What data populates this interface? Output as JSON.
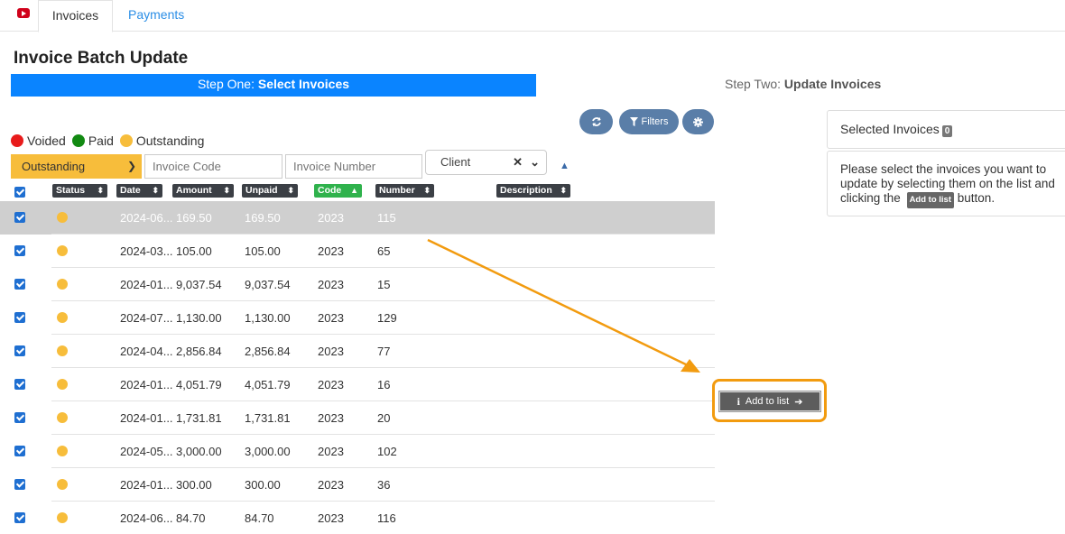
{
  "tabs": [
    {
      "label": "Invoices",
      "active": true
    },
    {
      "label": "Payments",
      "active": false
    }
  ],
  "page_title": "Invoice Batch Update",
  "steps": {
    "one_prefix": "Step One: ",
    "one_bold": "Select Invoices",
    "two_prefix": "Step Two: ",
    "two_bold": "Update Invoices"
  },
  "toolbar": {
    "filters_label": "Filters"
  },
  "legend": [
    {
      "label": "Voided",
      "color": "#e81b1b"
    },
    {
      "label": "Paid",
      "color": "#128a12"
    },
    {
      "label": "Outstanding",
      "color": "#f7bd3b"
    }
  ],
  "filters": {
    "status_value": "Outstanding",
    "invoice_code_placeholder": "Invoice Code",
    "invoice_number_placeholder": "Invoice Number",
    "client_placeholder": "Client"
  },
  "columns": {
    "status": "Status",
    "date": "Date",
    "amount": "Amount",
    "unpaid": "Unpaid",
    "code": "Code",
    "number": "Number",
    "description": "Description"
  },
  "rows": [
    {
      "date": "2024-06...",
      "amount": "169.50",
      "unpaid": "169.50",
      "code": "2023",
      "number": "115",
      "selected": true
    },
    {
      "date": "2024-03...",
      "amount": "105.00",
      "unpaid": "105.00",
      "code": "2023",
      "number": "65"
    },
    {
      "date": "2024-01...",
      "amount": "9,037.54",
      "unpaid": "9,037.54",
      "code": "2023",
      "number": "15"
    },
    {
      "date": "2024-07...",
      "amount": "1,130.00",
      "unpaid": "1,130.00",
      "code": "2023",
      "number": "129"
    },
    {
      "date": "2024-04...",
      "amount": "2,856.84",
      "unpaid": "2,856.84",
      "code": "2023",
      "number": "77"
    },
    {
      "date": "2024-01...",
      "amount": "4,051.79",
      "unpaid": "4,051.79",
      "code": "2023",
      "number": "16"
    },
    {
      "date": "2024-01...",
      "amount": "1,731.81",
      "unpaid": "1,731.81",
      "code": "2023",
      "number": "20"
    },
    {
      "date": "2024-05...",
      "amount": "3,000.00",
      "unpaid": "3,000.00",
      "code": "2023",
      "number": "102"
    },
    {
      "date": "2024-01...",
      "amount": "300.00",
      "unpaid": "300.00",
      "code": "2023",
      "number": "36"
    },
    {
      "date": "2024-06...",
      "amount": "84.70",
      "unpaid": "84.70",
      "code": "2023",
      "number": "116"
    }
  ],
  "selected_panel": {
    "title": "Selected Invoices",
    "count": "0",
    "message_before": "Please select the invoices you want to update by selecting them on the list and clicking the",
    "message_badge": "Add to list",
    "message_after": "button."
  },
  "add_to_list_label": "Add to list",
  "colors": {
    "accent_blue": "#0a84ff",
    "outstanding": "#f7bd3b",
    "highlight_orange": "#f29b0f"
  }
}
